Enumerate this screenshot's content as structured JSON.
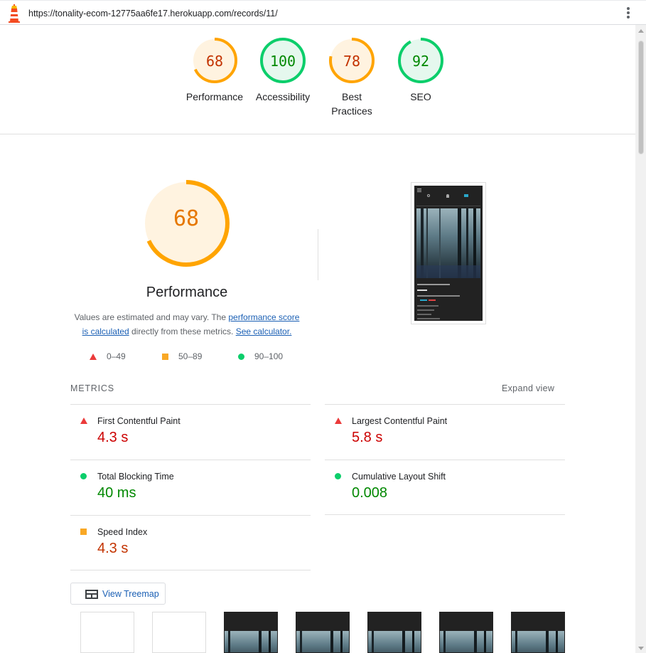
{
  "url": "https://tonality-ecom-12775aa6fe17.herokuapp.com/records/11/",
  "gauges": [
    {
      "label": "Performance",
      "score": "68",
      "value": 68,
      "color": "#ffa400",
      "text_color": "#c33300",
      "bg": "#fff3e0"
    },
    {
      "label": "Accessibility",
      "score": "100",
      "value": 100,
      "color": "#0cce6b",
      "text_color": "#080",
      "bg": "#e5f8ee"
    },
    {
      "label": "Best Practices",
      "score": "78",
      "value": 78,
      "color": "#ffa400",
      "text_color": "#c33300",
      "bg": "#fff3e0"
    },
    {
      "label": "SEO",
      "score": "92",
      "value": 92,
      "color": "#0cce6b",
      "text_color": "#080",
      "bg": "#e5f8ee"
    }
  ],
  "performance": {
    "score": "68",
    "title": "Performance",
    "desc_prefix": "Values are estimated and may vary. The ",
    "link1": "performance score is calculated",
    "desc_mid": " directly from these metrics. ",
    "link2": "See calculator."
  },
  "legend": {
    "low": "0–49",
    "mid": "50–89",
    "high": "90–100"
  },
  "metrics_header": "METRICS",
  "expand_view": "Expand view",
  "metrics": {
    "fcp": {
      "title": "First Contentful Paint",
      "value": "4.3 s"
    },
    "lcp": {
      "title": "Largest Contentful Paint",
      "value": "5.8 s"
    },
    "tbt": {
      "title": "Total Blocking Time",
      "value": "40 ms"
    },
    "cls": {
      "title": "Cumulative Layout Shift",
      "value": "0.008"
    },
    "si": {
      "title": "Speed Index",
      "value": "4.3 s"
    }
  },
  "treemap_label": "View Treemap",
  "icons": {
    "logo": "lighthouse-icon",
    "menu": "kebab-menu-icon",
    "treemap": "treemap-icon",
    "fail": "red-triangle-icon",
    "average": "orange-square-icon",
    "pass": "green-circle-icon"
  }
}
